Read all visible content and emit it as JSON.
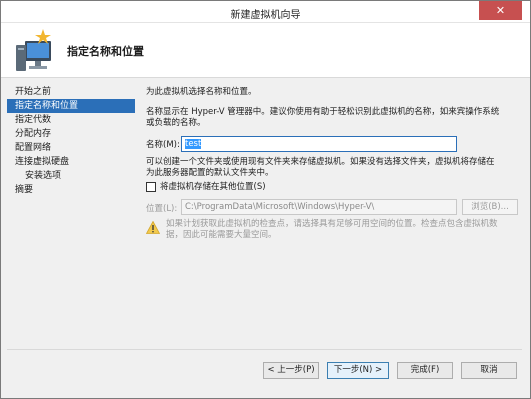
{
  "window": {
    "title": "新建虚拟机向导",
    "close_glyph": "✕"
  },
  "header": {
    "title": "指定名称和位置",
    "icon": "new-vm-wizard-icon"
  },
  "sidebar": {
    "items": [
      {
        "label": "开始之前"
      },
      {
        "label": "指定名称和位置"
      },
      {
        "label": "指定代数"
      },
      {
        "label": "分配内存"
      },
      {
        "label": "配置网络"
      },
      {
        "label": "连接虚拟硬盘"
      },
      {
        "label": "安装选项"
      },
      {
        "label": "摘要"
      }
    ]
  },
  "content": {
    "intro": "为此虚拟机选择名称和位置。",
    "name_desc_1": "名称显示在 Hyper-V 管理器中。建议你使用有助于轻松识别此虚拟机的名称，如来宾操作系统",
    "name_desc_2": "或负载的名称。",
    "name_label": "名称(M):",
    "name_value": "test",
    "folder_desc_1": "可以创建一个文件夹或使用现有文件夹来存储虚拟机。如果没有选择文件夹，虚拟机将存储在",
    "folder_desc_2": "为此服务器配置的默认文件夹中。",
    "store_elsewhere_label": "将虚拟机存储在其他位置(S)",
    "store_elsewhere_checked": false,
    "location_label": "位置(L):",
    "location_value": "C:\\ProgramData\\Microsoft\\Windows\\Hyper-V\\",
    "browse_label": "浏览(B)...",
    "warning_1": "如果计划获取此虚拟机的检查点，请选择具有足够可用空间的位置。检查点包含虚拟机数",
    "warning_2": "据，因此可能需要大量空间。"
  },
  "buttons": {
    "previous": "< 上一步(P)",
    "next": "下一步(N) >",
    "finish": "完成(F)",
    "cancel": "取消"
  },
  "colors": {
    "selection": "#2b6fb8",
    "close": "#c75050",
    "warning": "#f2c94c"
  }
}
